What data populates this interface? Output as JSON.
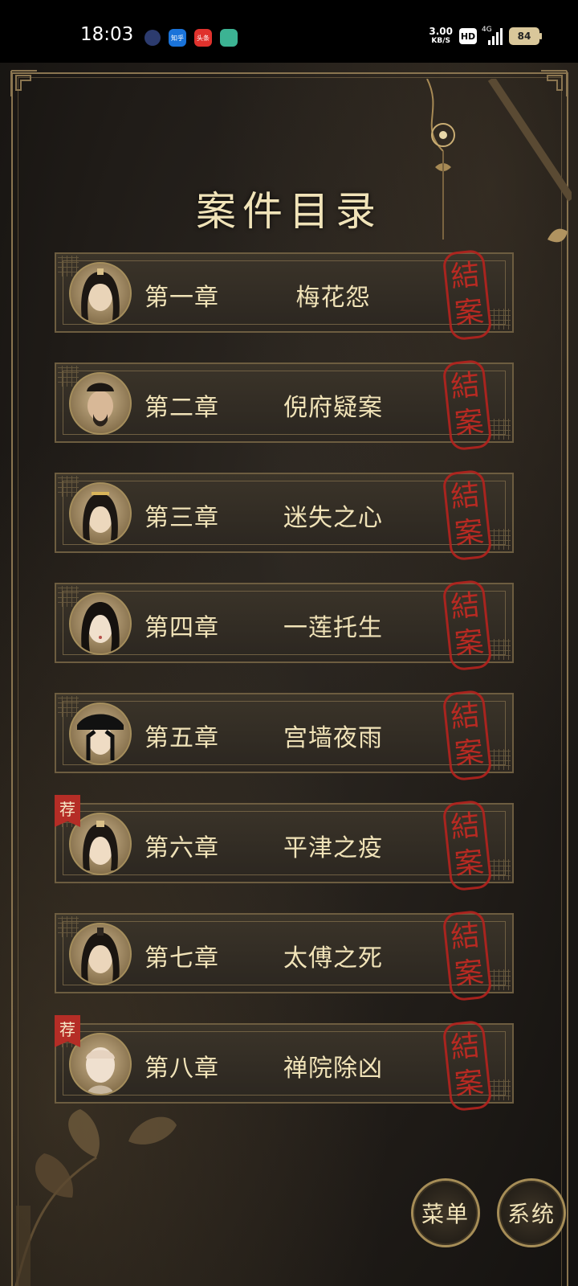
{
  "status_bar": {
    "time": "18:03",
    "net_speed_value": "3.00",
    "net_speed_unit": "KB/S",
    "hd_label": "HD",
    "network_type": "4G",
    "battery": "84",
    "app_icons": [
      {
        "name": "chat-bubble-icon",
        "label": ""
      },
      {
        "name": "zhihu-app-icon",
        "label": "知乎"
      },
      {
        "name": "toutiao-app-icon",
        "label": "头条"
      },
      {
        "name": "green-app-icon",
        "label": ""
      }
    ]
  },
  "page": {
    "title": "案件目录"
  },
  "chapters": [
    {
      "number": "第一章",
      "name": "梅花怨",
      "stamp": [
        "結",
        "案"
      ],
      "recommended": false
    },
    {
      "number": "第二章",
      "name": "倪府疑案",
      "stamp": [
        "結",
        "案"
      ],
      "recommended": false
    },
    {
      "number": "第三章",
      "name": "迷失之心",
      "stamp": [
        "結",
        "案"
      ],
      "recommended": false
    },
    {
      "number": "第四章",
      "name": "一莲托生",
      "stamp": [
        "結",
        "案"
      ],
      "recommended": false
    },
    {
      "number": "第五章",
      "name": "宫墙夜雨",
      "stamp": [
        "結",
        "案"
      ],
      "recommended": false
    },
    {
      "number": "第六章",
      "name": "平津之疫",
      "stamp": [
        "結",
        "案"
      ],
      "recommended": true,
      "badge": "荐"
    },
    {
      "number": "第七章",
      "name": "太傅之死",
      "stamp": [
        "結",
        "案"
      ],
      "recommended": false
    },
    {
      "number": "第八章",
      "name": "禅院除凶",
      "stamp": [
        "結",
        "案"
      ],
      "recommended": true,
      "badge": "荐"
    }
  ],
  "bottom_buttons": {
    "menu_label": "菜单",
    "system_label": "系统"
  },
  "colors": {
    "gold_text": "#f1e3b8",
    "frame_gold": "#8a7550",
    "stamp_red": "#b3231e",
    "badge_red": "#b52d26",
    "background": "#1f1b17"
  }
}
